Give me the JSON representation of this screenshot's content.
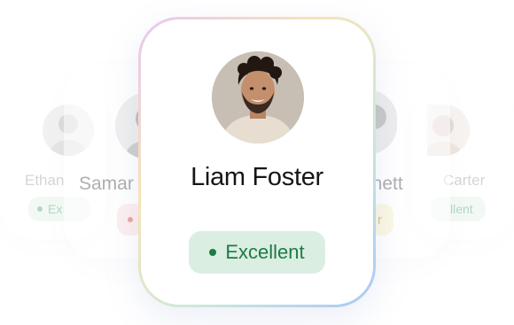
{
  "cards": {
    "far_left": {
      "name": "Ethan",
      "status": "Ex"
    },
    "mid_left": {
      "name": "Samar",
      "status": ""
    },
    "main": {
      "name": "Liam Foster",
      "status": "Excellent"
    },
    "mid_right": {
      "name": "nnett",
      "status": "r"
    },
    "far_right": {
      "name": "Carter",
      "status": "llent"
    }
  },
  "colors": {
    "excellent_bg": "#dbeee2",
    "excellent_text": "#1f7a45",
    "warning_bg": "#fde3e3",
    "warning_dot": "#e25b5b",
    "yellow_bg": "#fbf3cf",
    "border_gradient": [
      "#e8c7f2",
      "#f7e3b8",
      "#cde9d9",
      "#a9c8f6"
    ]
  }
}
